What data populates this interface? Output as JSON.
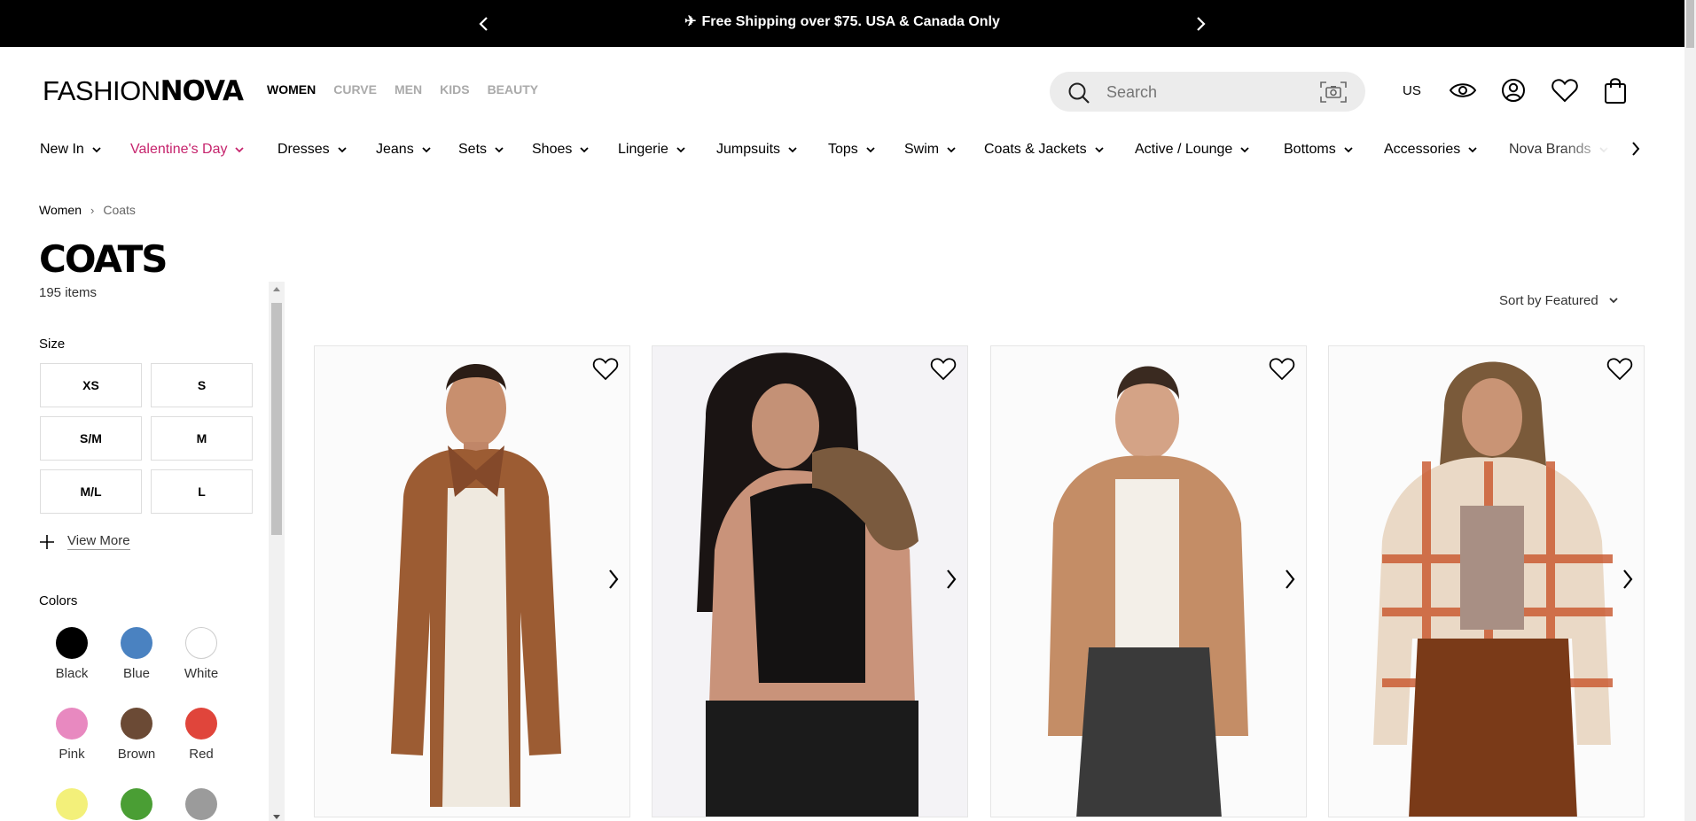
{
  "promo": {
    "message": "Free Shipping over $75. USA & Canada Only",
    "icon": "airplane-icon"
  },
  "header": {
    "logo_thin": "FASHION",
    "logo_bold": "NOVA",
    "topnav": [
      "WOMEN",
      "CURVE",
      "MEN",
      "KIDS",
      "BEAUTY"
    ],
    "search_placeholder": "Search",
    "region": "US"
  },
  "categories": [
    "New In",
    "Valentine's Day",
    "Dresses",
    "Jeans",
    "Sets",
    "Shoes",
    "Lingerie",
    "Jumpsuits",
    "Tops",
    "Swim",
    "Coats & Jackets",
    "Active / Lounge",
    "Bottoms",
    "Accessories",
    "Nova Brands"
  ],
  "breadcrumb": {
    "home": "Women",
    "separator": "›",
    "current": "Coats"
  },
  "page": {
    "title": "COATS",
    "count": "195 items"
  },
  "filters": {
    "size_title": "Size",
    "sizes": [
      "XS",
      "S",
      "S/M",
      "M",
      "M/L",
      "L"
    ],
    "view_more": "View More",
    "colors_title": "Colors",
    "colors": [
      {
        "name": "Black",
        "hex": "#000000"
      },
      {
        "name": "Blue",
        "hex": "#4a82c1"
      },
      {
        "name": "White",
        "hex": "#ffffff"
      },
      {
        "name": "Pink",
        "hex": "#e889c0"
      },
      {
        "name": "Brown",
        "hex": "#6b4a35"
      },
      {
        "name": "Red",
        "hex": "#e0453b"
      },
      {
        "name": "Yellow",
        "hex": "#f3f07a"
      },
      {
        "name": "Green",
        "hex": "#4a9e34"
      },
      {
        "name": "Grey",
        "hex": "#9b9b9b"
      }
    ]
  },
  "sort": {
    "label": "Sort by Featured"
  },
  "colors": {
    "accent_pink": "#c6246d",
    "promo_bg": "#000000",
    "search_bg": "#ececec"
  }
}
